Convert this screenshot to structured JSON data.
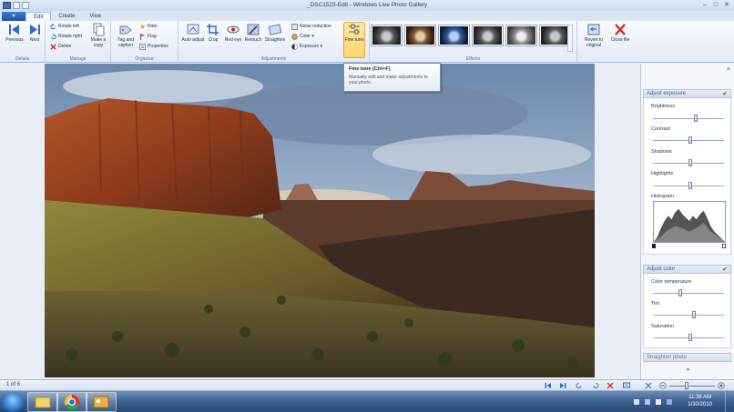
{
  "window": {
    "title": "_DSC1523-Edit - Windows Live Photo Gallery",
    "min": "–",
    "max": "□",
    "close": "✕"
  },
  "tabs": [
    "Edit",
    "Create",
    "View"
  ],
  "ribbon": {
    "details": {
      "label": "Details",
      "previous": "Previous",
      "next": "Next"
    },
    "manage": {
      "label": "Manage",
      "rotate_left": "Rotate left",
      "rotate_right": "Rotate right",
      "delete": "Delete",
      "make_copy": "Make a copy"
    },
    "organize": {
      "label": "Organize",
      "tag_caption": "Tag and caption",
      "rate": "Rate",
      "flag": "Flag",
      "properties": "Properties"
    },
    "adjustments": {
      "label": "Adjustments",
      "auto_adjust": "Auto adjust",
      "crop": "Crop",
      "red_eye": "Red eye",
      "retouch": "Retouch",
      "straighten": "Straighten",
      "noise_reduction": "Noise reduction",
      "color": "Color",
      "exposure": "Exposure",
      "fine_tune": "Fine tune"
    },
    "effects": {
      "label": "Effects"
    },
    "revert": "Revert to original",
    "close_file": "Close file"
  },
  "tooltip": {
    "title": "Fine tune (Ctrl+F)",
    "description": "Manually edit and make adjustments to your photo."
  },
  "panel": {
    "close": "×",
    "adjust_exposure": {
      "title": "Adjust exposure",
      "brightness": "Brightness",
      "contrast": "Contrast",
      "shadows": "Shadows",
      "highlights": "Highlights",
      "histogram": "Histogram"
    },
    "adjust_color": {
      "title": "Adjust color",
      "temperature": "Color temperature",
      "tint": "Tint",
      "saturation": "Saturation"
    },
    "straighten": "Straighten photo",
    "expand": "⌄"
  },
  "slider_levels": {
    "brightness": 0.6,
    "contrast": 0.53,
    "shadows": 0.53,
    "highlights": 0.53,
    "color_temperature": 0.38,
    "tint": 0.58,
    "saturation": 0.53
  },
  "status": {
    "count": "1 of 6"
  },
  "taskbar": {
    "time": "11:36 AM",
    "date": "1/30/2010"
  },
  "colors": {
    "accent": "#2a5aa0",
    "ribbon": "#e3ebf6",
    "taskbar": "#3c5f8c"
  }
}
